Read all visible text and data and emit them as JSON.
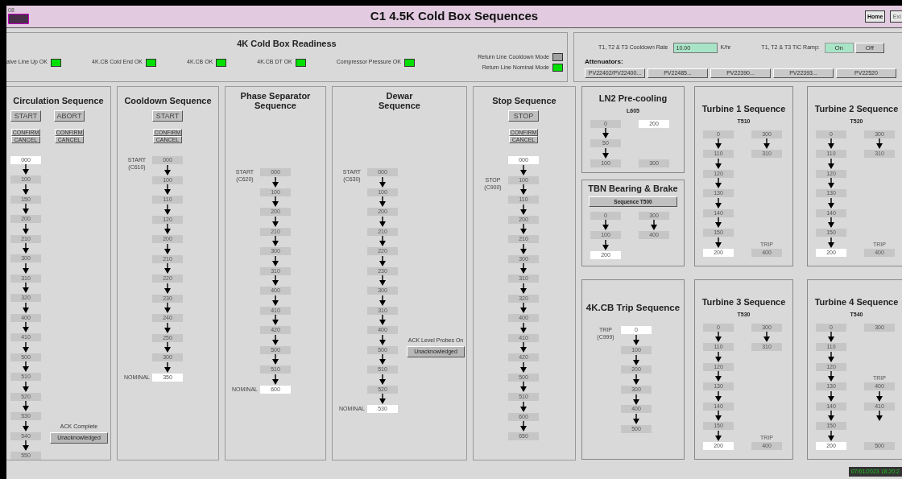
{
  "header": {
    "tag": "08",
    "title": "C1 4.5K Cold Box Sequences",
    "buttons": [
      "Home",
      "Exi"
    ]
  },
  "readiness": {
    "title": "4K Cold Box Readiness",
    "indicators": [
      {
        "label": "alve Line Up OK",
        "ok": true
      },
      {
        "label": "4K.CB Cold End OK",
        "ok": true
      },
      {
        "label": "4K.CB OK",
        "ok": true
      },
      {
        "label": "4K.CB DT OK",
        "ok": true
      },
      {
        "label": "Compressor Pressure OK",
        "ok": true
      }
    ],
    "return_lines": [
      {
        "label": "Return Line Cooldown Mode",
        "on": false
      },
      {
        "label": "Return Line Nominal Mode",
        "on": true
      }
    ]
  },
  "controls": {
    "rate_label": "T1, T2 & T3 Cooldown Rate",
    "rate_value": "10.00",
    "rate_unit": "K/hr",
    "ramp_label": "T1, T2 & T3 TIC Ramp:",
    "ramp_options": [
      {
        "label": "On",
        "selected": true
      },
      {
        "label": "Off",
        "selected": false
      }
    ],
    "attenuators_label": "Attenuators:",
    "attenuators": [
      "PV22402/PV22400...",
      "PV22485...",
      "PV22390...",
      "PV22393...",
      "PV22520"
    ]
  },
  "sequences": [
    {
      "title": "Circulation Sequence",
      "buttons": [
        {
          "label": "START",
          "confirm": "CONFIRM",
          "cancel": "CANCEL"
        },
        {
          "label": "ABORT",
          "confirm": "CONFIRM",
          "cancel": "CANCEL"
        }
      ],
      "steps": [
        {
          "value": "000",
          "active": true
        },
        {
          "value": "100",
          "active": false
        },
        {
          "value": "150",
          "active": false
        },
        {
          "value": "200",
          "active": false
        },
        {
          "value": "210",
          "active": false
        },
        {
          "value": "300",
          "active": false
        },
        {
          "value": "310",
          "active": false
        },
        {
          "value": "320",
          "active": false
        },
        {
          "value": "400",
          "active": false
        },
        {
          "value": "410",
          "active": false
        },
        {
          "value": "500",
          "active": false
        },
        {
          "value": "510",
          "active": false
        },
        {
          "value": "520",
          "active": false
        },
        {
          "value": "530",
          "active": false
        },
        {
          "value": "540",
          "active": false,
          "ack": {
            "label": "ACK Complete",
            "button": "Unacknowledged"
          }
        },
        {
          "value": "550",
          "active": false
        }
      ]
    },
    {
      "title": "Cooldown Sequence",
      "buttons": [
        {
          "label": "START",
          "confirm": "CONFIRM",
          "cancel": "CANCEL"
        }
      ],
      "steps": [
        {
          "value": "000",
          "active": false,
          "label": "START (C610)"
        },
        {
          "value": "100",
          "active": false
        },
        {
          "value": "110",
          "active": false
        },
        {
          "value": "120",
          "active": false
        },
        {
          "value": "200",
          "active": false
        },
        {
          "value": "210",
          "active": false
        },
        {
          "value": "220",
          "active": false
        },
        {
          "value": "230",
          "active": false
        },
        {
          "value": "240",
          "active": false
        },
        {
          "value": "250",
          "active": false
        },
        {
          "value": "300",
          "active": false
        },
        {
          "value": "350",
          "active": true,
          "label": "NOMINAL"
        }
      ]
    },
    {
      "title": "Phase Separator Sequence",
      "steps": [
        {
          "value": "000",
          "active": false,
          "label": "START (C620)"
        },
        {
          "value": "100",
          "active": false
        },
        {
          "value": "200",
          "active": false
        },
        {
          "value": "210",
          "active": false
        },
        {
          "value": "300",
          "active": false
        },
        {
          "value": "310",
          "active": false
        },
        {
          "value": "400",
          "active": false
        },
        {
          "value": "410",
          "active": false
        },
        {
          "value": "420",
          "active": false
        },
        {
          "value": "500",
          "active": false
        },
        {
          "value": "510",
          "active": false
        },
        {
          "value": "600",
          "active": true,
          "label": "NOMINAL"
        }
      ]
    },
    {
      "title": "Dewar Sequence",
      "steps": [
        {
          "value": "000",
          "active": false,
          "label": "START (C630)"
        },
        {
          "value": "100",
          "active": false
        },
        {
          "value": "200",
          "active": false
        },
        {
          "value": "210",
          "active": false
        },
        {
          "value": "220",
          "active": false
        },
        {
          "value": "230",
          "active": false
        },
        {
          "value": "300",
          "active": false
        },
        {
          "value": "310",
          "active": false
        },
        {
          "value": "400",
          "active": false
        },
        {
          "value": "500",
          "active": false,
          "ack": {
            "label": "ACK Level Probes On",
            "button": "Unacknowledged"
          }
        },
        {
          "value": "510",
          "active": false
        },
        {
          "value": "520",
          "active": false
        },
        {
          "value": "530",
          "active": true,
          "label": "NOMINAL"
        }
      ]
    },
    {
      "title": "Stop Sequence",
      "buttons": [
        {
          "label": "STOP",
          "confirm": "CONFIRM",
          "cancel": "CANCEL"
        }
      ],
      "steps": [
        {
          "value": "000",
          "active": true
        },
        {
          "value": "100",
          "active": false,
          "label": "STOP (C900)"
        },
        {
          "value": "110",
          "active": false
        },
        {
          "value": "200",
          "active": false
        },
        {
          "value": "210",
          "active": false
        },
        {
          "value": "300",
          "active": false
        },
        {
          "value": "310",
          "active": false
        },
        {
          "value": "320",
          "active": false
        },
        {
          "value": "400",
          "active": false
        },
        {
          "value": "410",
          "active": false
        },
        {
          "value": "420",
          "active": false
        },
        {
          "value": "500",
          "active": false
        },
        {
          "value": "510",
          "active": false
        },
        {
          "value": "600",
          "active": false
        },
        {
          "value": "650",
          "active": false
        }
      ]
    }
  ],
  "panel_columns": [
    {
      "panels": [
        {
          "kind": "pair",
          "title": "LN2 Pre-cooling",
          "code": "L605",
          "steps": [
            {
              "value": "0",
              "active": false,
              "beside": {
                "value": "200",
                "active": true,
                "arrow": false
              }
            },
            {
              "value": "50",
              "active": false
            },
            {
              "value": "100",
              "active": false,
              "beside": {
                "value": "300",
                "active": false,
                "arrow": false
              }
            }
          ]
        },
        {
          "kind": "pair",
          "title": "TBN Bearing & Brake",
          "button": "Sequence T500",
          "steps": [
            {
              "value": "0",
              "active": false,
              "beside": {
                "value": "300",
                "active": false,
                "arrow": true
              }
            },
            {
              "value": "100",
              "active": false,
              "beside": {
                "value": "400",
                "active": false,
                "arrow": false
              }
            },
            {
              "value": "200",
              "active": true
            }
          ]
        },
        {
          "kind": "chain",
          "title": "4K.CB Trip Sequence",
          "steps": [
            {
              "value": "0",
              "active": true,
              "label": "TRIP (C999)"
            },
            {
              "value": "100",
              "active": false
            },
            {
              "value": "200",
              "active": false
            },
            {
              "value": "300",
              "active": false
            },
            {
              "value": "400",
              "active": false
            },
            {
              "value": "500",
              "active": false
            }
          ]
        }
      ]
    },
    {
      "panels": [
        {
          "kind": "pair",
          "title": "Turbine 1 Sequence",
          "code": "T510",
          "steps": [
            {
              "value": "0",
              "active": false,
              "beside": {
                "value": "300",
                "active": false,
                "arrow": true
              }
            },
            {
              "value": "110",
              "active": false,
              "beside": {
                "value": "310",
                "active": false,
                "arrow": false
              }
            },
            {
              "value": "120",
              "active": false
            },
            {
              "value": "130",
              "active": false
            },
            {
              "value": "140",
              "active": false
            },
            {
              "value": "150",
              "active": false
            },
            {
              "value": "200",
              "active": true,
              "beside": {
                "label": "TRIP",
                "value": "400",
                "active": false,
                "arrow": false
              }
            }
          ]
        },
        {
          "kind": "pair",
          "title": "Turbine 3 Sequence",
          "code": "T530",
          "steps": [
            {
              "value": "0",
              "active": false,
              "beside": {
                "value": "300",
                "active": false,
                "arrow": true
              }
            },
            {
              "value": "110",
              "active": false,
              "beside": {
                "value": "310",
                "active": false,
                "arrow": false
              }
            },
            {
              "value": "120",
              "active": false
            },
            {
              "value": "130",
              "active": false
            },
            {
              "value": "140",
              "active": false
            },
            {
              "value": "150",
              "active": false
            },
            {
              "value": "200",
              "active": true,
              "beside": {
                "label": "TRIP",
                "value": "400",
                "active": false,
                "arrow": false
              }
            }
          ]
        }
      ]
    },
    {
      "panels": [
        {
          "kind": "pair",
          "title": "Turbine 2 Sequence",
          "code": "T520",
          "steps": [
            {
              "value": "0",
              "active": false,
              "beside": {
                "value": "300",
                "active": false,
                "arrow": true
              }
            },
            {
              "value": "110",
              "active": false,
              "beside": {
                "value": "310",
                "active": false,
                "arrow": false
              }
            },
            {
              "value": "120",
              "active": false
            },
            {
              "value": "130",
              "active": false
            },
            {
              "value": "140",
              "active": false
            },
            {
              "value": "150",
              "active": false
            },
            {
              "value": "200",
              "active": true,
              "beside": {
                "label": "TRIP",
                "value": "400",
                "active": false,
                "arrow": false
              }
            }
          ]
        },
        {
          "kind": "pair",
          "title": "Turbine 4 Sequence",
          "code": "T540",
          "steps": [
            {
              "value": "0",
              "active": false,
              "beside": {
                "value": "300",
                "active": false,
                "arrow": false
              }
            },
            {
              "value": "110",
              "active": false
            },
            {
              "value": "120",
              "active": false
            },
            {
              "value": "130",
              "active": false,
              "beside": {
                "label": "TRIP",
                "value": "400",
                "active": false,
                "arrow": true
              }
            },
            {
              "value": "140",
              "active": false,
              "beside": {
                "value": "410",
                "active": false,
                "arrow": true
              }
            },
            {
              "value": "150",
              "active": false
            },
            {
              "value": "200",
              "active": true,
              "beside": {
                "value": "500",
                "active": false,
                "arrow": false
              }
            }
          ]
        }
      ]
    }
  ],
  "timestamp": "07/01/2023 18:20:2"
}
